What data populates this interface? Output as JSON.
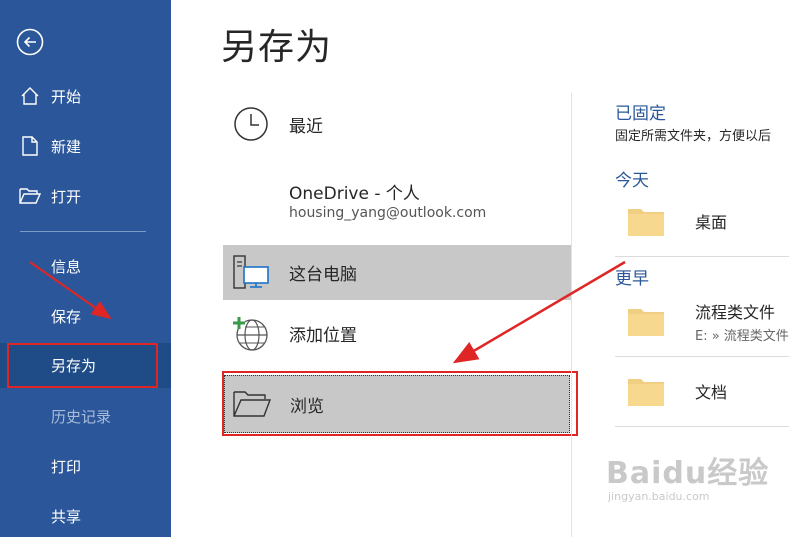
{
  "sidebar": {
    "items": [
      {
        "label": "开始",
        "icon": "home-icon"
      },
      {
        "label": "新建",
        "icon": "new-document-icon"
      },
      {
        "label": "打开",
        "icon": "open-folder-icon"
      },
      {
        "label": "信息"
      },
      {
        "label": "保存"
      },
      {
        "label": "另存为",
        "selected": true
      },
      {
        "label": "历史记录",
        "disabled": true
      },
      {
        "label": "打印"
      },
      {
        "label": "共享"
      }
    ],
    "background_color": "#2b579a"
  },
  "main": {
    "title": "另存为",
    "locations": [
      {
        "label": "最近",
        "icon": "clock-icon"
      },
      {
        "label": "OneDrive - 个人",
        "sublabel": "housing_yang@outlook.com"
      },
      {
        "label": "这台电脑",
        "icon": "computer-icon",
        "active": true
      },
      {
        "label": "添加位置",
        "icon": "globe-add-icon"
      },
      {
        "label": "浏览",
        "icon": "folder-icon",
        "highlighted": true
      }
    ]
  },
  "right_panel": {
    "pinned": {
      "heading": "已固定",
      "description": "固定所需文件夹，方便以后"
    },
    "today": {
      "heading": "今天",
      "folders": [
        {
          "name": "桌面"
        }
      ]
    },
    "earlier": {
      "heading": "更早",
      "folders": [
        {
          "name": "流程类文件",
          "path": "E: » 流程类文件"
        },
        {
          "name": "文档"
        }
      ]
    },
    "accent_color": "#2b579a"
  },
  "watermark": {
    "brand": "Baidu经验",
    "url": "jingyan.baidu.com"
  },
  "annotation_color": "#e02525"
}
